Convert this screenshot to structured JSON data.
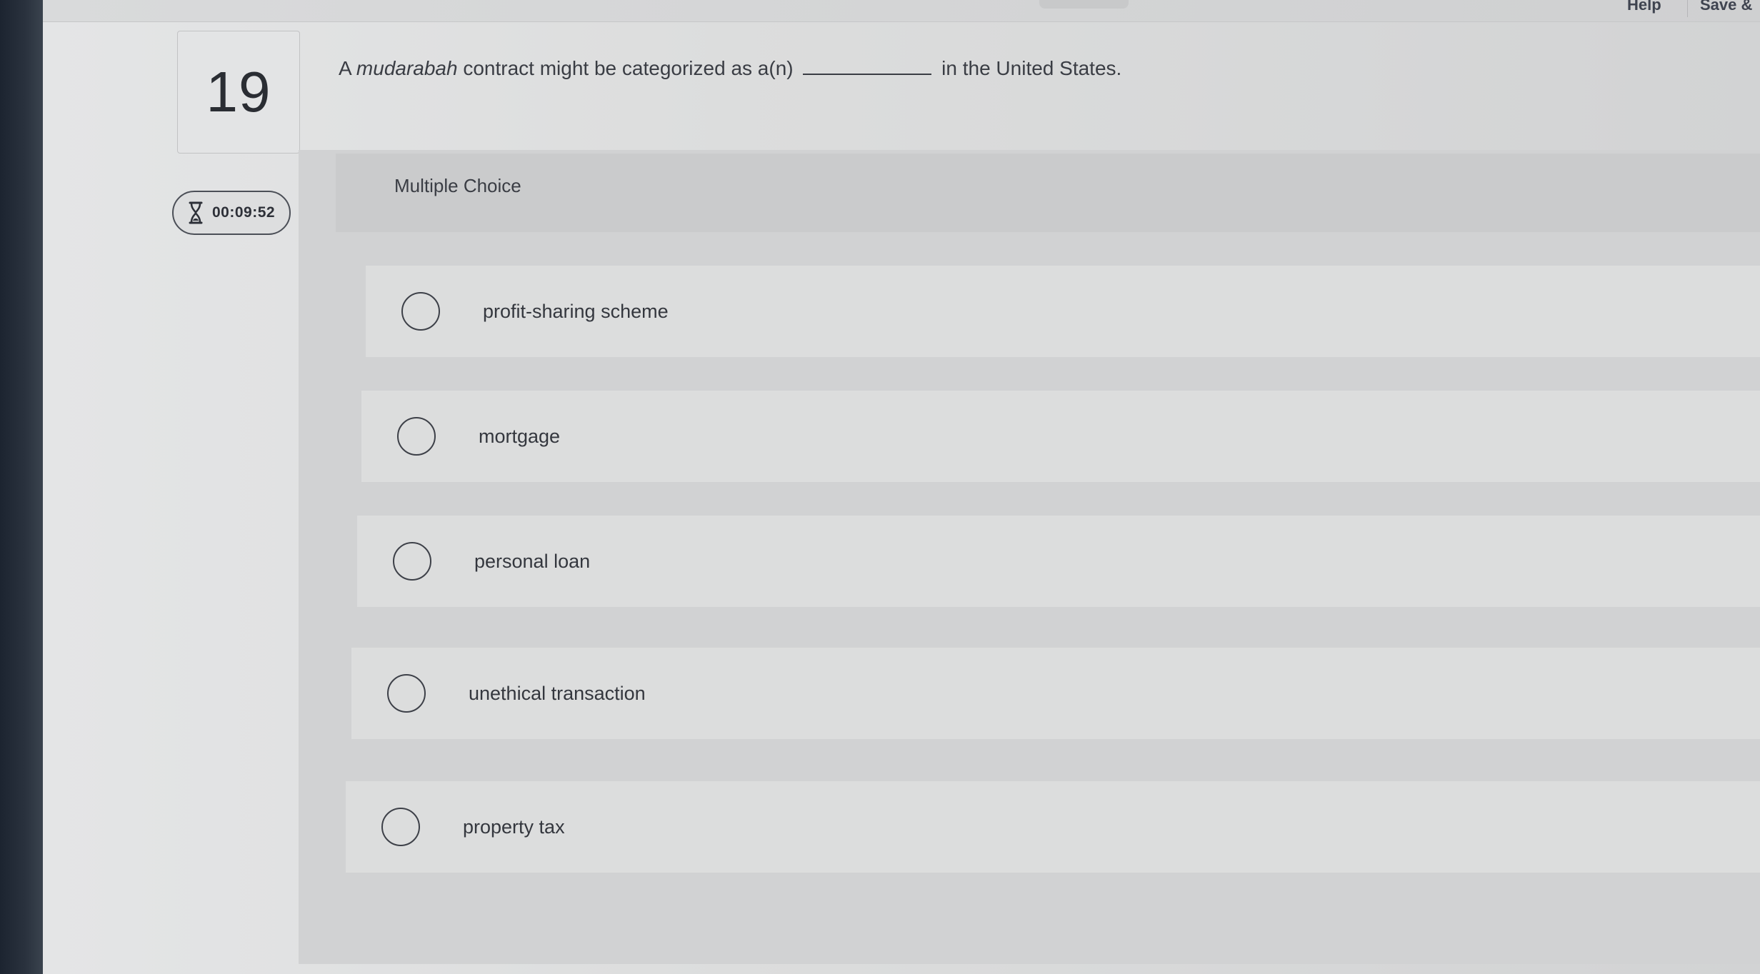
{
  "topbar": {
    "help_label": "Help",
    "save_label": "Save &"
  },
  "question": {
    "number": "19",
    "timer": "00:09:52",
    "text_prefix": "A ",
    "text_italic": "mudarabah",
    "text_middle": " contract might be categorized as a(n) ",
    "text_suffix": " in the United States."
  },
  "answer_section": {
    "type_label": "Multiple Choice",
    "options": [
      {
        "label": "profit-sharing scheme",
        "selected": false
      },
      {
        "label": "mortgage",
        "selected": false
      },
      {
        "label": "personal loan",
        "selected": false
      },
      {
        "label": "unethical transaction",
        "selected": false
      },
      {
        "label": "property tax",
        "selected": false
      }
    ]
  },
  "icons": {
    "timer": "hourglass-icon"
  }
}
